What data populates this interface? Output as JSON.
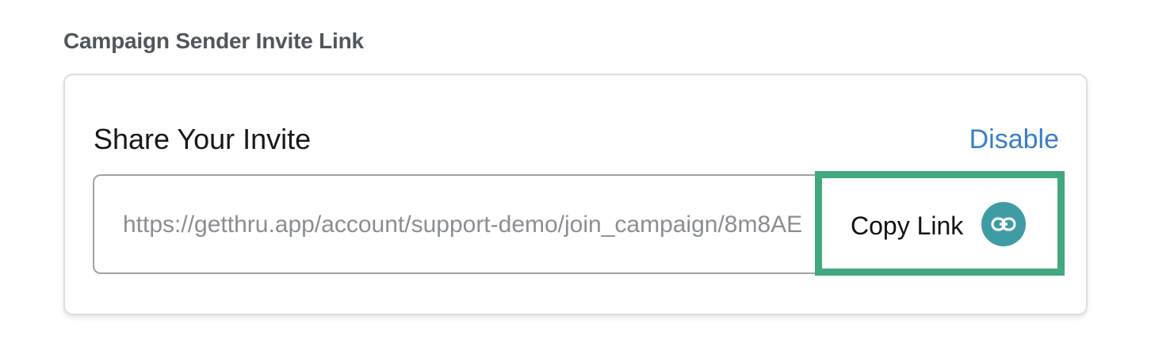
{
  "section": {
    "title": "Campaign Sender Invite Link"
  },
  "card": {
    "heading": "Share Your Invite",
    "disable_label": "Disable"
  },
  "invite": {
    "url": "https://getthru.app/account/support-demo/join_campaign/8m8AE",
    "copy_label": "Copy Link",
    "copy_icon": "link-icon"
  },
  "colors": {
    "accent_link": "#3a7ec6",
    "highlight_border": "#42a87e",
    "icon_bg": "#3f9ba4"
  }
}
